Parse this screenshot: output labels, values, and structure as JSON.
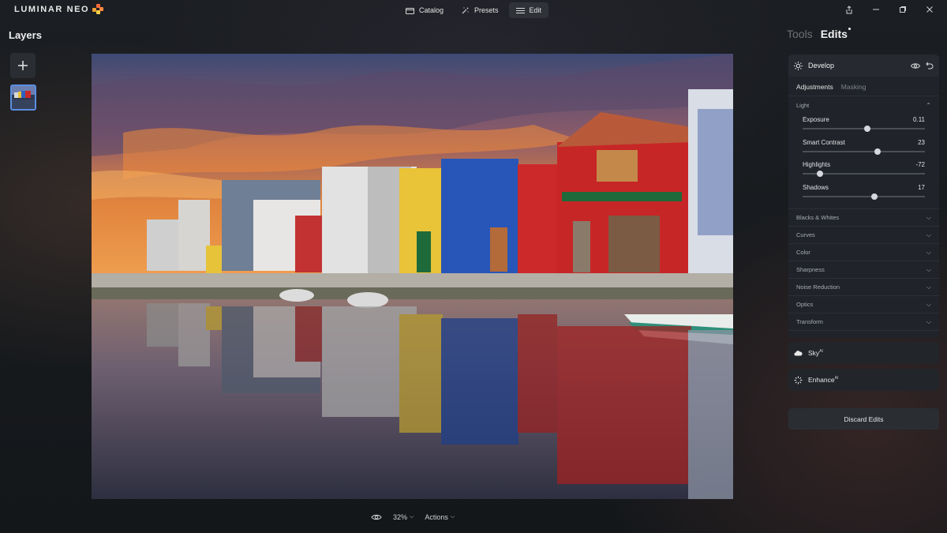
{
  "app": {
    "logo_text": "LUMINAR NEO"
  },
  "nav": {
    "tabs": [
      {
        "label": "Catalog",
        "icon": "folder-icon",
        "active": false
      },
      {
        "label": "Presets",
        "icon": "magic-wand-icon",
        "active": false
      },
      {
        "label": "Edit",
        "icon": "sliders-icon",
        "active": true
      }
    ]
  },
  "window": {
    "controls": [
      "share-icon",
      "minimize-icon",
      "restore-icon",
      "close-icon"
    ]
  },
  "layers": {
    "title": "Layers"
  },
  "bottom": {
    "zoom": "32%",
    "actions_label": "Actions"
  },
  "panel": {
    "tools_label": "Tools",
    "edits_label": "Edits",
    "develop": {
      "title": "Develop",
      "subtabs": [
        "Adjustments",
        "Masking"
      ],
      "light_label": "Light",
      "sliders": [
        {
          "label": "Exposure",
          "value": "0.11",
          "position": 0.527
        },
        {
          "label": "Smart Contrast",
          "value": "23",
          "position": 0.615
        },
        {
          "label": "Highlights",
          "value": "-72",
          "position": 0.14
        },
        {
          "label": "Shadows",
          "value": "17",
          "position": 0.585
        }
      ],
      "sections": [
        "Blacks & Whites",
        "Curves",
        "Color",
        "Sharpness",
        "Noise Reduction",
        "Optics",
        "Transform"
      ]
    },
    "sky_label": "Sky",
    "enhance_label": "Enhance",
    "ai_badge": "AI",
    "discard_label": "Discard Edits"
  },
  "colors": {
    "accent": "#5b8fe0",
    "panel_bg": "#20242a"
  }
}
